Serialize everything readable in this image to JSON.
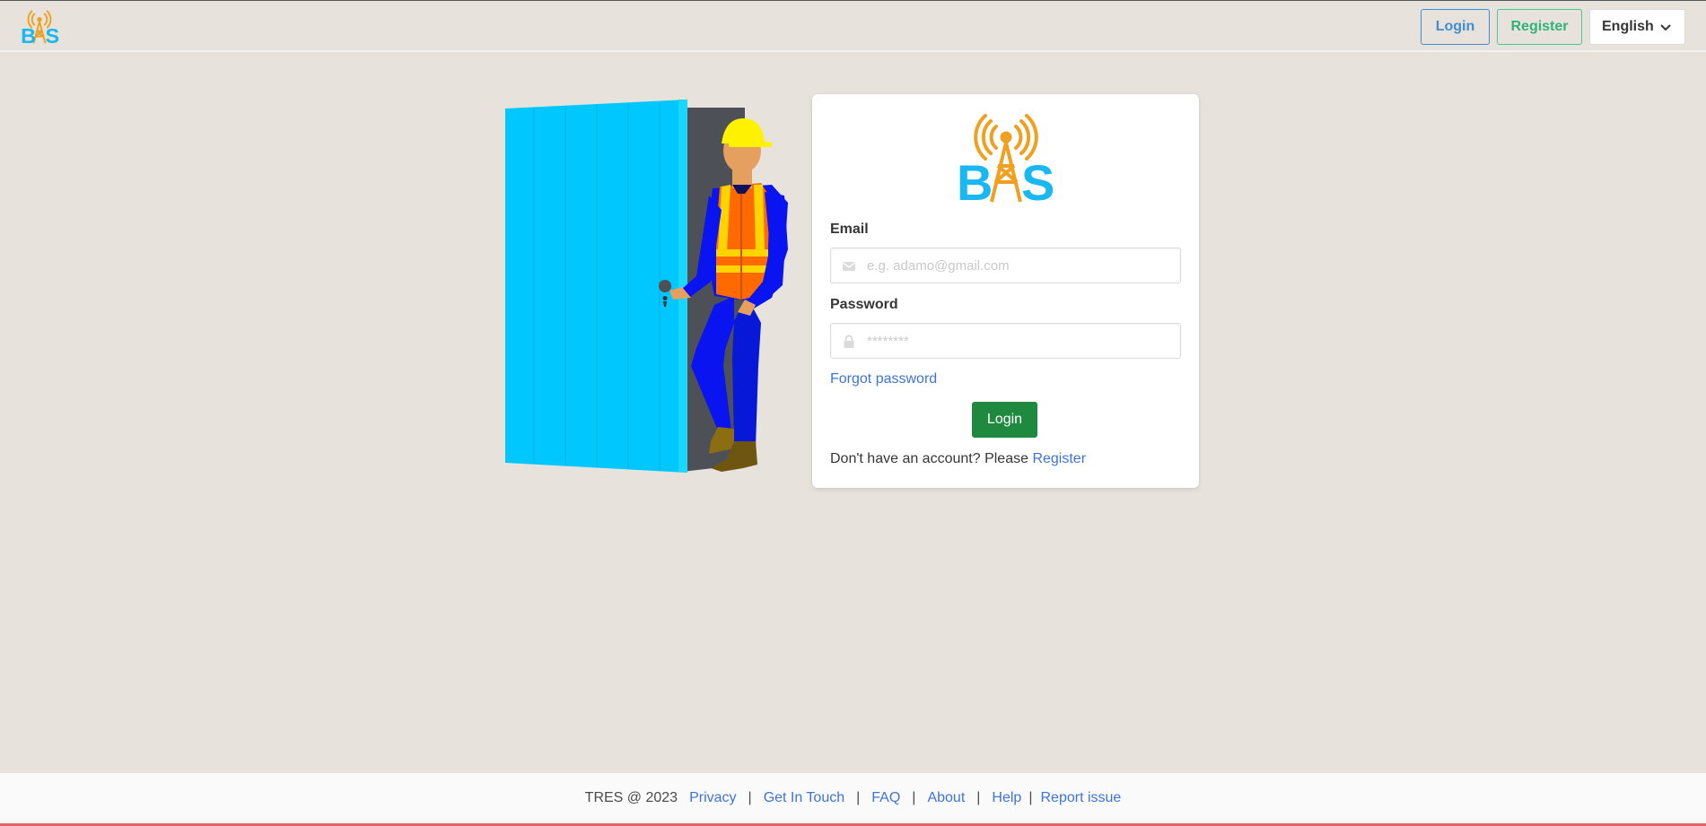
{
  "navbar": {
    "brand_text": "BTS",
    "login_label": "Login",
    "register_label": "Register",
    "language_selected": "English",
    "brand_colors": {
      "antenna": "#f0a020",
      "letters": "#1ab8f0"
    }
  },
  "form": {
    "logo_text": "BTS",
    "email_label": "Email",
    "email_placeholder": "e.g. adamo@gmail.com",
    "email_icon": "envelope-icon",
    "password_label": "Password",
    "password_placeholder": "********",
    "password_icon": "lock-icon",
    "forgot_password": "Forgot password",
    "login_button": "Login",
    "signup_prompt": "Don't have an account? Please",
    "signup_link": "Register"
  },
  "footer": {
    "copyright": "TRES @ 2023",
    "links": [
      "Privacy",
      "Get In Touch",
      "FAQ",
      "About",
      "Help",
      "Report issue"
    ]
  },
  "colors": {
    "page_bg": "#e7e3dc",
    "login_button": "#1f8a3f",
    "link": "#3e74d6",
    "door": "#00c8ff",
    "worker_vest": "#ff6a00",
    "worker_suit": "#0a14f0",
    "helmet": "#fff200"
  }
}
